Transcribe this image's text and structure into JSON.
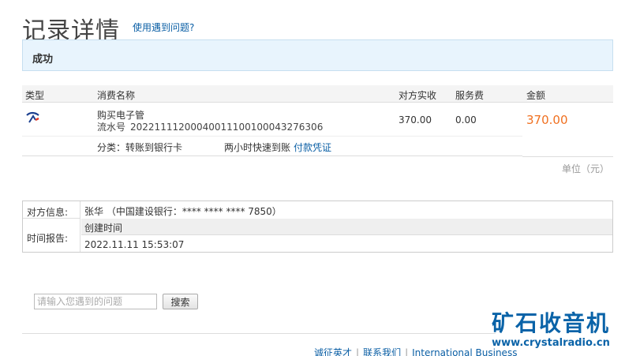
{
  "page": {
    "title": "记录详情",
    "help_link": "使用遇到问题?"
  },
  "status": {
    "text": "成功"
  },
  "detail_table": {
    "headers": {
      "type": "类型",
      "name": "消费名称",
      "received": "对方实收",
      "fee": "服务费",
      "amount": "金额"
    },
    "row": {
      "type_icon": "transfer-icon",
      "name": "购买电子管",
      "serial_label": "流水号",
      "serial": "20221111200040011100100043276306",
      "received": "370.00",
      "fee": "0.00",
      "amount": "370.00"
    },
    "category": "分类：转账到银行卡",
    "transfer_speed": "两小时快速到账",
    "voucher_link": "付款凭证",
    "unit_note": "单位（元）"
  },
  "info_table": {
    "party_label": "对方信息:",
    "party_value": "张华 （中国建设银行：**** **** **** 7850）",
    "report_label": "时间报告:",
    "created_label": "创建时间",
    "created_time": "2022.11.11 15:53:07"
  },
  "search": {
    "placeholder": "请输入您遇到的问题",
    "button": "搜索"
  },
  "footer": {
    "link1": "诚征英才",
    "link2": "联系我们",
    "link3": "International Business"
  },
  "watermark": {
    "name": "矿石收音机",
    "url": "www.crystalradio.cn"
  },
  "colors": {
    "accent": "#0b5fa5",
    "amount": "#f07020",
    "status_bg": "#e8f4fd"
  }
}
